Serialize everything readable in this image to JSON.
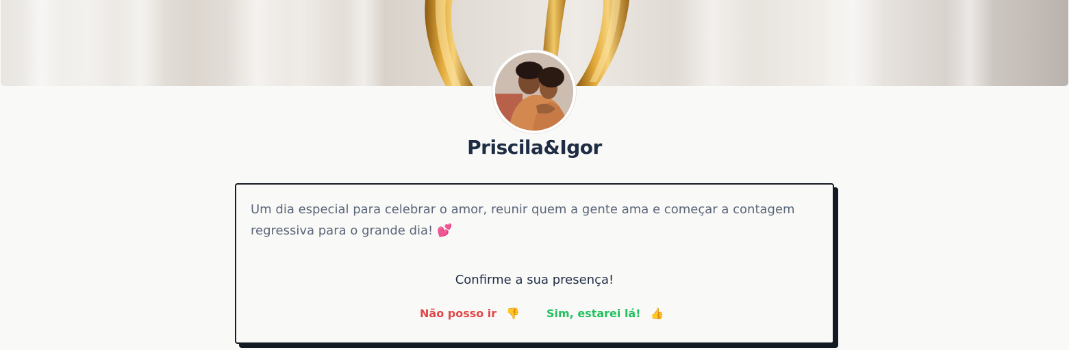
{
  "profile": {
    "name": "Priscila&Igor",
    "cover_image": "wedding-rings-cover",
    "avatar_image": "couple-photo"
  },
  "invite": {
    "description": "Um dia especial para celebrar o amor, reunir quem a gente ama e começar a contagem regressiva para o grande dia!",
    "description_emoji": "💕",
    "confirm_prompt": "Confirme a sua presença!",
    "decline_label": "Não posso ir",
    "decline_emoji": "👎",
    "accept_label": "Sim, estarei lá!",
    "accept_emoji": "👍"
  },
  "colors": {
    "title": "#1e2c44",
    "text": "#5a6578",
    "decline": "#e04848",
    "accept": "#22c05e",
    "card_border": "#141a24"
  }
}
